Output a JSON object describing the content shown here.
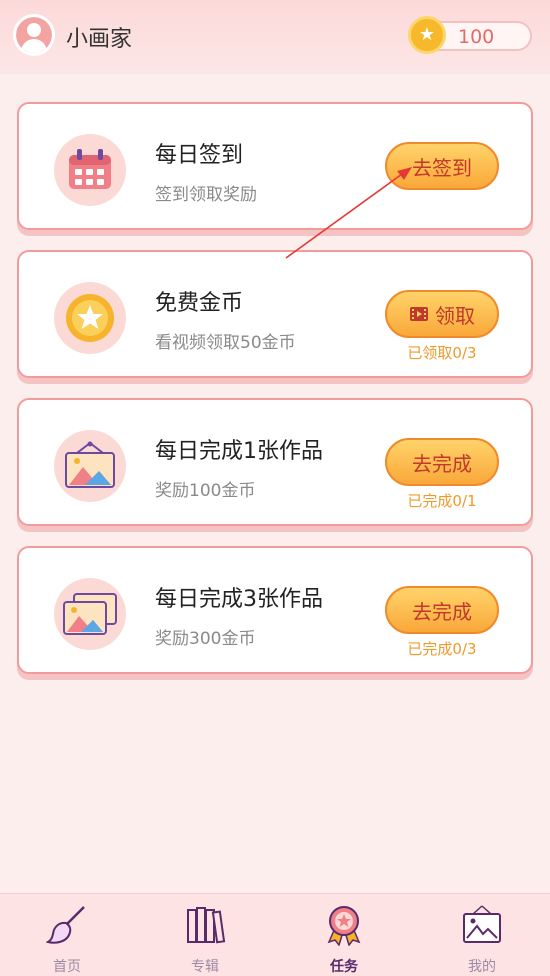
{
  "header": {
    "username": "小画家",
    "coin_amount": "100",
    "avatar_icon": "user-avatar-icon",
    "coin_icon": "gold-star-coin-icon"
  },
  "tasks": [
    {
      "title": "每日签到",
      "subtitle": "签到领取奖励",
      "action_label": "去签到",
      "progress": "",
      "icon": "calendar-icon"
    },
    {
      "title": "免费金币",
      "subtitle": "看视频领取50金币",
      "action_label": "领取",
      "action_icon": "video-icon",
      "progress": "已领取0/3",
      "icon": "star-coin-icon"
    },
    {
      "title": "每日完成1张作品",
      "subtitle": "奖励100金币",
      "action_label": "去完成",
      "progress": "已完成0/1",
      "icon": "picture-icon"
    },
    {
      "title": "每日完成3张作品",
      "subtitle": "奖励300金币",
      "action_label": "去完成",
      "progress": "已完成0/3",
      "icon": "pictures-stack-icon"
    }
  ],
  "nav": [
    {
      "label": "首页",
      "icon": "paintbrush-icon",
      "active": false
    },
    {
      "label": "专辑",
      "icon": "books-icon",
      "active": false
    },
    {
      "label": "任务",
      "icon": "medal-icon",
      "active": true
    },
    {
      "label": "我的",
      "icon": "picture-frame-icon",
      "active": false
    }
  ],
  "colors": {
    "accent": "#f39b9b",
    "button_gradient_top": "#ffd36a",
    "button_gradient_bottom": "#f9a83a",
    "button_text": "#c0392b",
    "progress_text": "#f09a2a",
    "annotation_arrow": "#e53935"
  }
}
